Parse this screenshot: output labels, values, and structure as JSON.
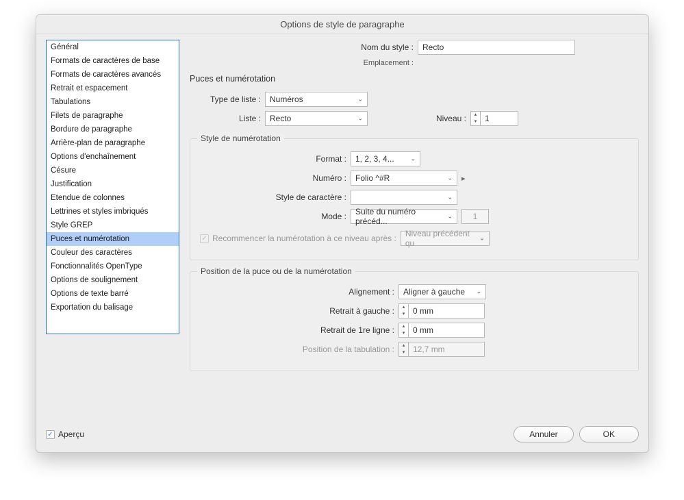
{
  "title": "Options de style de paragraphe",
  "sidebar": {
    "items": [
      "Général",
      "Formats de caractères de base",
      "Formats de caractères avancés",
      "Retrait et espacement",
      "Tabulations",
      "Filets de paragraphe",
      "Bordure de paragraphe",
      "Arrière-plan de paragraphe",
      "Options d'enchaînement",
      "Césure",
      "Justification",
      "Etendue de colonnes",
      "Lettrines et styles imbriqués",
      "Style GREP",
      "Puces et numérotation",
      "Couleur des caractères",
      "Fonctionnalités OpenType",
      "Options de soulignement",
      "Options de texte barré",
      "Exportation du balisage"
    ],
    "selected_index": 14
  },
  "header": {
    "style_name_label": "Nom du style :",
    "style_name_value": "Recto",
    "location_label": "Emplacement :"
  },
  "section_title": "Puces et numérotation",
  "list": {
    "type_label": "Type de liste :",
    "type_value": "Numéros",
    "list_label": "Liste :",
    "list_value": "Recto",
    "level_label": "Niveau :",
    "level_value": "1"
  },
  "numbering_style": {
    "legend": "Style de numérotation",
    "format_label": "Format :",
    "format_value": "1, 2, 3, 4...",
    "number_label": "Numéro :",
    "number_value": "Folio ^#R",
    "char_style_label": "Style de caractère :",
    "char_style_value": "",
    "mode_label": "Mode :",
    "mode_value": "Suite du numéro précéd...",
    "mode_start_value": "1",
    "restart_label": "Recommencer la numérotation à ce niveau après :",
    "restart_value": "Niveau précédent qu"
  },
  "position": {
    "legend": "Position de la puce ou de la numérotation",
    "alignment_label": "Alignement :",
    "alignment_value": "Aligner à gauche",
    "left_indent_label": "Retrait à gauche :",
    "left_indent_value": "0 mm",
    "first_line_label": "Retrait de 1re ligne :",
    "first_line_value": "0 mm",
    "tab_pos_label": "Position de la tabulation :",
    "tab_pos_value": "12,7 mm"
  },
  "footer": {
    "preview_label": "Aperçu",
    "cancel": "Annuler",
    "ok": "OK"
  }
}
